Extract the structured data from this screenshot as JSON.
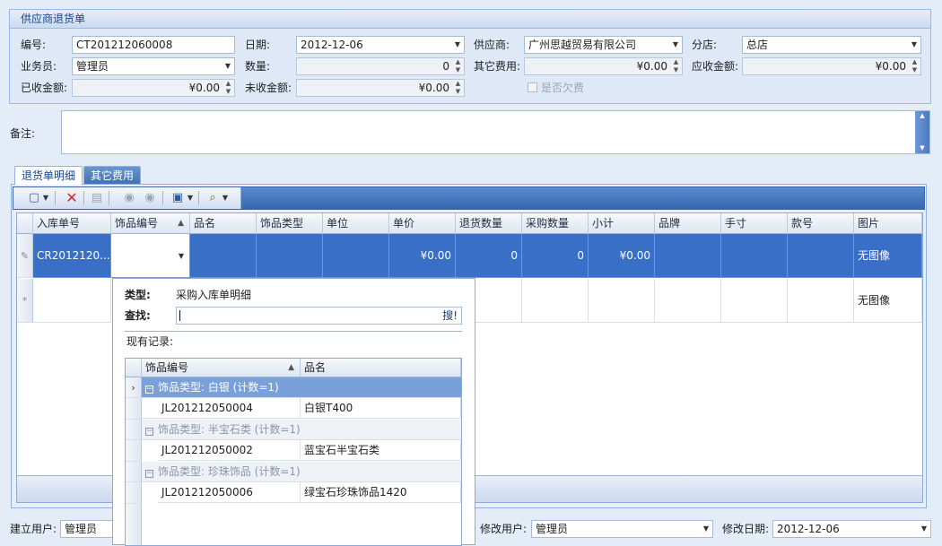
{
  "form": {
    "title": "供应商退货单",
    "no_label": "编号:",
    "no_value": "CT201212060008",
    "date_label": "日期:",
    "date_value": "2012-12-06",
    "supplier_label": "供应商:",
    "supplier_value": "广州思越贸易有限公司",
    "branch_label": "分店:",
    "branch_value": "总店",
    "clerk_label": "业务员:",
    "clerk_value": "管理员",
    "qty_label": "数量:",
    "qty_value": "0",
    "other_fee_label": "其它费用:",
    "other_fee_value": "¥0.00",
    "receivable_label": "应收金额:",
    "receivable_value": "¥0.00",
    "received_label": "已收金额:",
    "received_value": "¥0.00",
    "unreceived_label": "未收金额:",
    "unreceived_value": "¥0.00",
    "owe_label": "是否欠费"
  },
  "remark": {
    "label": "备注:"
  },
  "tabs": [
    {
      "label": "退货单明细"
    },
    {
      "label": "其它费用"
    }
  ],
  "grid": {
    "headers": [
      "入库单号",
      "饰品编号",
      "品名",
      "饰品类型",
      "单位",
      "单价",
      "退货数量",
      "采购数量",
      "小计",
      "品牌",
      "手寸",
      "款号",
      "图片"
    ],
    "sort_arrow": "▲",
    "row1": {
      "ruku": "CR2012120...",
      "price": "¥0.00",
      "return_qty": "0",
      "purchase_qty": "0",
      "subtotal": "¥0.00",
      "image": "无图像"
    },
    "row2": {
      "image": "无图像"
    }
  },
  "popup": {
    "type_label": "类型:",
    "type_value": "采购入库单明细",
    "find_label": "查找:",
    "search_button": "搜!",
    "records_label": "现有记录:",
    "headers": [
      "饰品编号",
      "品名"
    ],
    "groups": [
      {
        "title": "饰品类型: 白银 (计数=1)",
        "code": "JL201212050004",
        "name": "白银T400"
      },
      {
        "title": "饰品类型: 半宝石类 (计数=1)",
        "code": "JL201212050002",
        "name": "蓝宝石半宝石类"
      },
      {
        "title": "饰品类型: 珍珠饰品 (计数=1)",
        "code": "JL201212050006",
        "name": "绿宝石珍珠饰品1420"
      }
    ]
  },
  "footer": {
    "creator_label": "建立用户:",
    "creator_value": "管理员",
    "modifier_label": "修改用户:",
    "modifier_value": "管理员",
    "modified_date_label": "修改日期:",
    "modified_date_value": "2012-12-06"
  }
}
